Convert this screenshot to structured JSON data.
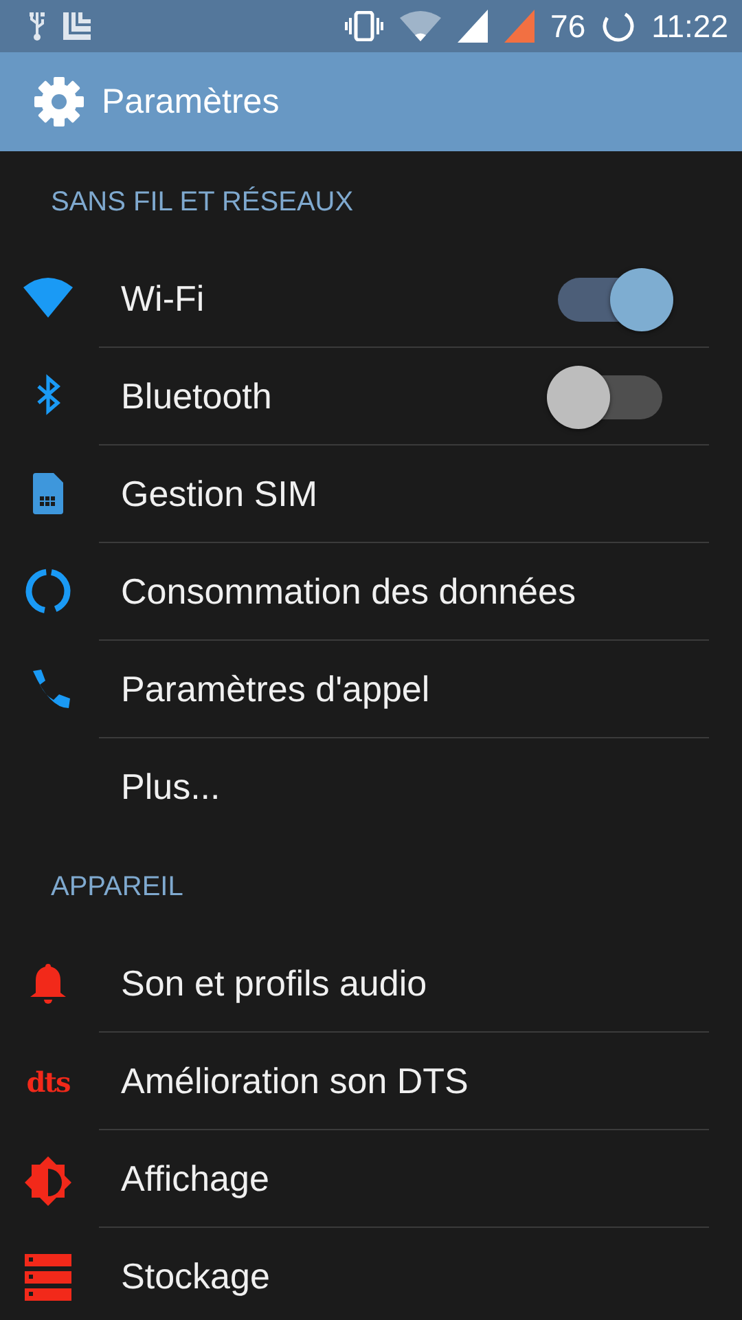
{
  "status_bar": {
    "battery": "76",
    "time": "11:22"
  },
  "app_bar": {
    "title": "Paramètres"
  },
  "sections": [
    {
      "header": "SANS FIL ET RÉSEAUX",
      "items": [
        {
          "kind": "toggle",
          "label": "Wi-Fi",
          "on": true
        },
        {
          "kind": "toggle",
          "label": "Bluetooth",
          "on": false
        },
        {
          "kind": "plain",
          "label": "Gestion SIM"
        },
        {
          "kind": "plain",
          "label": "Consommation des données"
        },
        {
          "kind": "plain",
          "label": "Paramètres d'appel"
        },
        {
          "kind": "plain",
          "label": "Plus..."
        }
      ]
    },
    {
      "header": "APPAREIL",
      "items": [
        {
          "kind": "plain",
          "label": "Son et profils audio"
        },
        {
          "kind": "logo",
          "logo": "dts",
          "label": "Amélioration son DTS"
        },
        {
          "kind": "plain",
          "label": "Affichage"
        },
        {
          "kind": "plain",
          "label": "Stockage"
        }
      ]
    }
  ]
}
